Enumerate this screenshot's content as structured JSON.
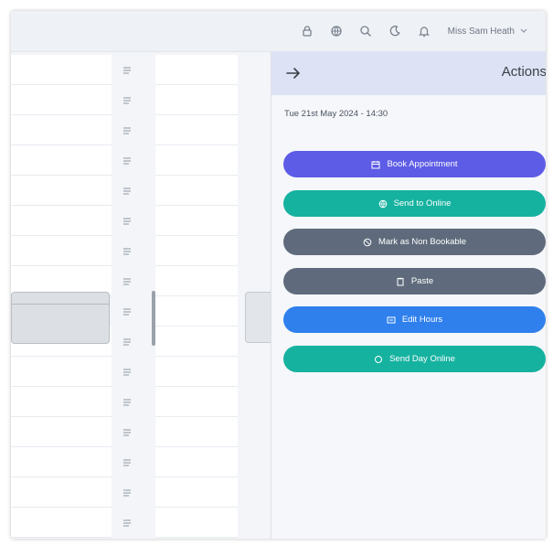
{
  "header": {
    "user_name": "Miss Sam Heath",
    "icons": [
      "lock-icon",
      "globe-icon",
      "search-icon",
      "moon-icon",
      "bell-icon"
    ]
  },
  "schedule": {
    "times": [
      "",
      "",
      "",
      "",
      "",
      "",
      "",
      "",
      "",
      "",
      "",
      "",
      "",
      "",
      ""
    ]
  },
  "panel": {
    "title": "Actions",
    "date": "Tue 21st May 2024 - 14:30",
    "buttons": [
      {
        "label": "Book Appointment",
        "icon": "calendar-icon",
        "color": "#5d5ce6"
      },
      {
        "label": "Send to Online",
        "icon": "globe-icon",
        "color": "#16b2a0"
      },
      {
        "label": "Mark as Non Bookable",
        "icon": "block-icon",
        "color": "#5f6b7c"
      },
      {
        "label": "Paste",
        "icon": "paste-icon",
        "color": "#5f6b7c"
      },
      {
        "label": "Edit Hours",
        "icon": "clock-icon",
        "color": "#2f80ed"
      },
      {
        "label": "Send Day Online",
        "icon": "cloud-icon",
        "color": "#16b2a0"
      }
    ]
  }
}
